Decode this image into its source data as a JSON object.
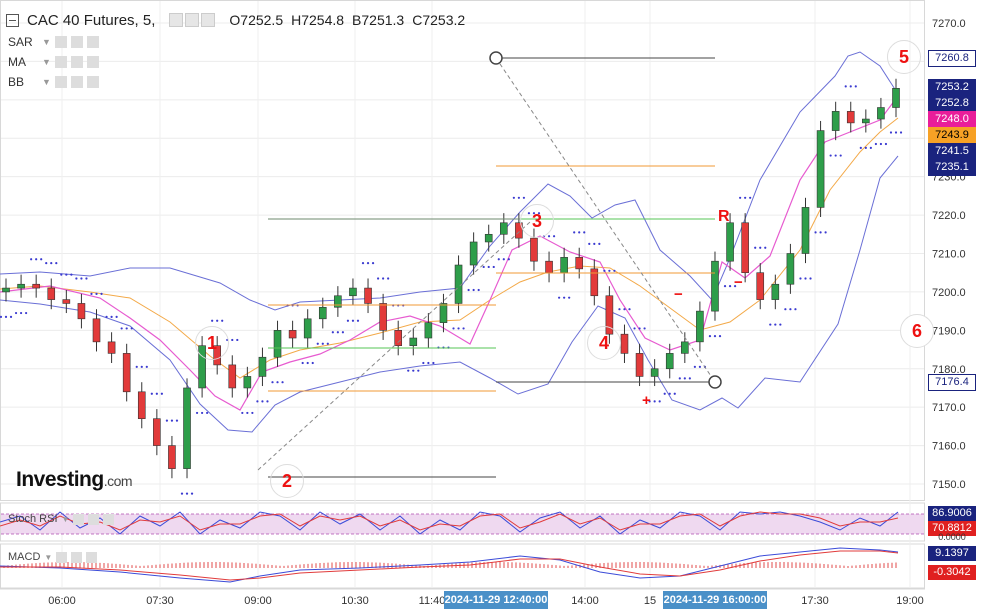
{
  "header": {
    "title": "CAC 40 Futures, 5,",
    "open": "O7252.5",
    "high": "H7254.8",
    "low": "B7251.3",
    "close": "C7253.2"
  },
  "indicators": [
    {
      "label": "SAR"
    },
    {
      "label": "MA"
    },
    {
      "label": "BB"
    }
  ],
  "brand": {
    "name": "Investing",
    "suffix": ".com"
  },
  "subpanels": {
    "stoch_label": "Stoch RSI",
    "stoch_values": [
      "86.9006",
      "70.8812",
      "0.0000"
    ],
    "macd_label": "MACD",
    "macd_values": [
      "9.1397",
      "-0.3042"
    ]
  },
  "annotations": [
    {
      "text": "1",
      "circled": true
    },
    {
      "text": "2",
      "circled": true
    },
    {
      "text": "3",
      "circled": true
    },
    {
      "text": "4",
      "circled": true
    },
    {
      "text": "5",
      "circled": true
    },
    {
      "text": "6",
      "circled": true
    },
    {
      "text": "R",
      "circled": false
    },
    {
      "text": "+",
      "circled": false
    },
    {
      "text": "−",
      "circled": false
    },
    {
      "text": "−",
      "circled": false
    }
  ],
  "price_tags": [
    {
      "value": "7260.8",
      "bg": "#ffffff",
      "fg": "#1a237e",
      "border": "#1a237e"
    },
    {
      "value": "7253.2",
      "bg": "#1a237e",
      "fg": "#ffffff",
      "border": "#1a237e"
    },
    {
      "value": "7252.8",
      "bg": "#1a237e",
      "fg": "#ffffff",
      "border": "#1a237e"
    },
    {
      "value": "7248.0",
      "bg": "#e91e9a",
      "fg": "#ffffff",
      "border": "#e91e9a"
    },
    {
      "value": "7243.9",
      "bg": "#f7a125",
      "fg": "#000000",
      "border": "#f7a125"
    },
    {
      "value": "7241.5",
      "bg": "#1a237e",
      "fg": "#ffffff",
      "border": "#1a237e"
    },
    {
      "value": "7235.1",
      "bg": "#1a237e",
      "fg": "#ffffff",
      "border": "#1a237e"
    },
    {
      "value": "7176.4",
      "bg": "#ffffff",
      "fg": "#1a237e",
      "border": "#1a237e"
    }
  ],
  "crosshair_labels": [
    "2024-11-29 12:40:00",
    "2024-11-29 16:00:00"
  ],
  "chart_data": {
    "type": "line",
    "title": "CAC 40 Futures, 5,",
    "ylim": [
      7145,
      7275
    ],
    "yticks": [
      7270,
      7260,
      7250,
      7240,
      7230,
      7220,
      7210,
      7200,
      7190,
      7180,
      7170,
      7160,
      7150
    ],
    "ytick_labels": [
      "7270.0",
      "7260.0",
      "7250.0",
      "7240.0",
      "7230.0",
      "7220.0",
      "7210.0",
      "7200.0",
      "7190.0",
      "7180.0",
      "7170.0",
      "7160.0",
      "7150.0"
    ],
    "x_labels": [
      "06:00",
      "07:30",
      "09:00",
      "10:30",
      "11:40",
      "14:00",
      "15",
      "17:30",
      "19:00"
    ],
    "grid": true,
    "series": [
      {
        "values": [
          7201,
          7202,
          7201,
          7198,
          7197,
          7193,
          7187,
          7184,
          7174,
          7167,
          7160,
          7154,
          7175,
          7186,
          7181,
          7175,
          7178,
          7183,
          7190,
          7188,
          7193,
          7196,
          7199,
          7201,
          7197,
          7190,
          7186,
          7188,
          7192,
          7197,
          7207,
          7213,
          7215,
          7218,
          7214,
          7208,
          7205,
          7209,
          7206,
          7199,
          7189,
          7184,
          7178,
          7180,
          7184,
          7187,
          7195,
          7208,
          7218,
          7205,
          7198,
          7202,
          7210,
          7222,
          7242,
          7247,
          7244,
          7245,
          7248,
          7253
        ]
      }
    ]
  }
}
